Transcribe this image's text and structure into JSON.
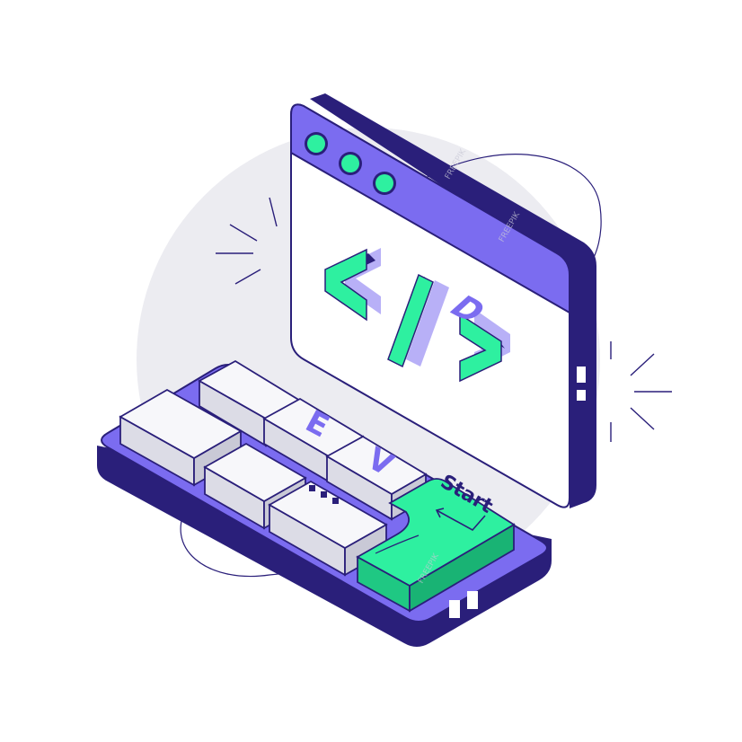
{
  "keyboard": {
    "keys": {
      "d": "D",
      "e": "E",
      "v": "V",
      "start": "Start"
    }
  },
  "window": {
    "code_symbol": "</>"
  },
  "watermark": "FREEPIK",
  "colors": {
    "outline": "#2a1f7a",
    "purple": "#7b6cf0",
    "purple_light": "#b8b0f7",
    "green": "#2ef0a0",
    "key_white": "#f7f7fa",
    "key_shade": "#dcdce6",
    "bg_circle": "#ececf1"
  }
}
